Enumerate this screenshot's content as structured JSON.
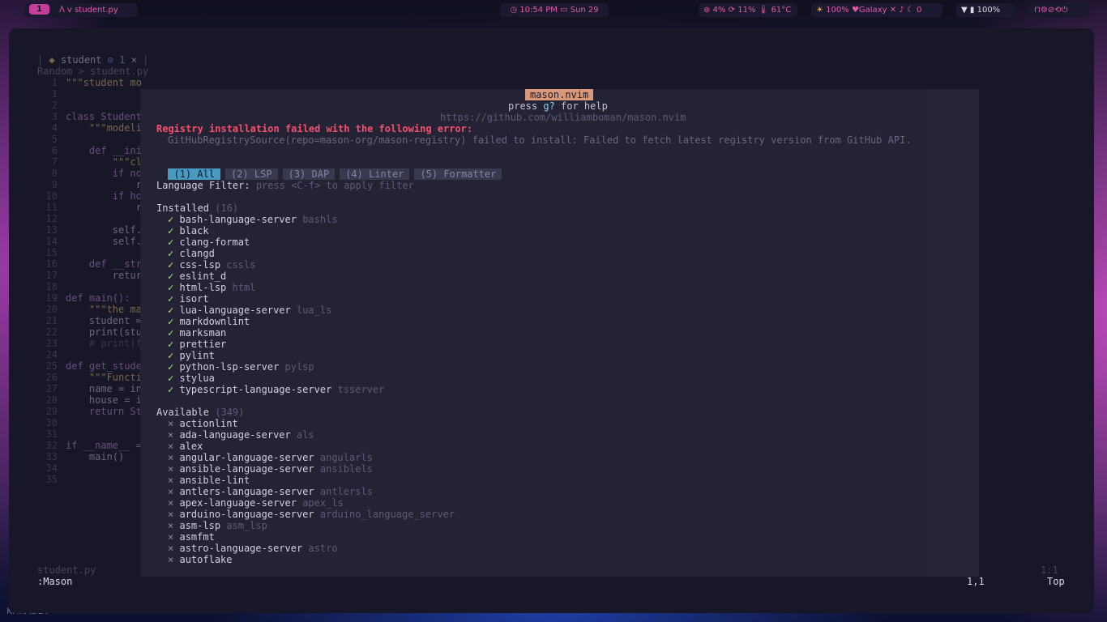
{
  "topbar": {
    "workspace": "1",
    "title": "ᐱ v student.py",
    "clock": "10:54 PM",
    "date": "Sun 29",
    "stats": "4%",
    "mem": "11%",
    "temp": "61°C",
    "brightness": "100%",
    "wifi": "Galaxy",
    "notif": "0",
    "battery": "100%"
  },
  "editor": {
    "tab_name": "student",
    "tab_diag": "1",
    "tab_close": "×",
    "breadcrumb": "Random > student.py",
    "line_numbers": [
      "1",
      "1",
      "2",
      "3",
      "4",
      "5",
      "6",
      "7",
      "8",
      "9",
      "10",
      "11",
      "12",
      "13",
      "14",
      "15",
      "16",
      "17",
      "18",
      "19",
      "20",
      "21",
      "22",
      "23",
      "24",
      "25",
      "26",
      "27",
      "28",
      "29",
      "30",
      "31",
      "32",
      "33",
      "34",
      "35"
    ],
    "lines": [
      "\"\"\"student mo",
      "",
      "",
      "class Student",
      "    \"\"\"modeli",
      "",
      "    def __ini",
      "        \"\"\"cl",
      "        if no",
      "            r",
      "        if ho",
      "            r",
      "",
      "        self.",
      "        self.",
      "",
      "    def __str",
      "        retur",
      "",
      "def main():",
      "    \"\"\"the ma",
      "    student =",
      "    print(stu",
      "    # print(f",
      "",
      "def get_stude",
      "    \"\"\"Functi",
      "    name = in",
      "    house = i",
      "    return St",
      "",
      "",
      "if __name__ =",
      "    main()"
    ],
    "status_file": "student.py",
    "status_pos": "1:1",
    "cmdline": ":Mason",
    "cursor": "1,1",
    "scroll": "Top"
  },
  "mason": {
    "title": "mason.nvim",
    "help_press": "press ",
    "help_key": "g?",
    "help_rest": " for help",
    "url": "https://github.com/williamboman/mason.nvim",
    "error_title": "Registry installation failed with the following error:",
    "error_detail": "GitHubRegistrySource(repo=mason-org/mason-registry) failed to install: Failed to fetch latest registry version from GitHub API.",
    "tabs": [
      "(1) All",
      "(2) LSP",
      "(3) DAP",
      "(4) Linter",
      "(5) Formatter"
    ],
    "filter_label": "Language Filter: ",
    "filter_hint": "press <C-f> to apply filter",
    "installed_label": "Installed ",
    "installed_count": "(16)",
    "installed": [
      {
        "name": "bash-language-server",
        "alias": "bashls"
      },
      {
        "name": "black",
        "alias": ""
      },
      {
        "name": "clang-format",
        "alias": ""
      },
      {
        "name": "clangd",
        "alias": ""
      },
      {
        "name": "css-lsp",
        "alias": "cssls"
      },
      {
        "name": "eslint_d",
        "alias": ""
      },
      {
        "name": "html-lsp",
        "alias": "html"
      },
      {
        "name": "isort",
        "alias": ""
      },
      {
        "name": "lua-language-server",
        "alias": "lua_ls"
      },
      {
        "name": "markdownlint",
        "alias": ""
      },
      {
        "name": "marksman",
        "alias": ""
      },
      {
        "name": "prettier",
        "alias": ""
      },
      {
        "name": "pylint",
        "alias": ""
      },
      {
        "name": "python-lsp-server",
        "alias": "pylsp"
      },
      {
        "name": "stylua",
        "alias": ""
      },
      {
        "name": "typescript-language-server",
        "alias": "tsserver"
      }
    ],
    "available_label": "Available ",
    "available_count": "(349)",
    "available": [
      {
        "name": "actionlint",
        "alias": ""
      },
      {
        "name": "ada-language-server",
        "alias": "als"
      },
      {
        "name": "alex",
        "alias": ""
      },
      {
        "name": "angular-language-server",
        "alias": "angularls"
      },
      {
        "name": "ansible-language-server",
        "alias": "ansiblels"
      },
      {
        "name": "ansible-lint",
        "alias": ""
      },
      {
        "name": "antlers-language-server",
        "alias": "antlersls"
      },
      {
        "name": "apex-language-server",
        "alias": "apex_ls"
      },
      {
        "name": "arduino-language-server",
        "alias": "arduino_language_server"
      },
      {
        "name": "asm-lsp",
        "alias": "asm_lsp"
      },
      {
        "name": "asmfmt",
        "alias": ""
      },
      {
        "name": "astro-language-server",
        "alias": "astro"
      },
      {
        "name": "autoflake",
        "alias": ""
      }
    ],
    "mark_ok": "✓",
    "mark_no": "×"
  },
  "watermark": "KHRADEV",
  "colors": {
    "accent": "#c43e9a",
    "error": "#ff5370",
    "tab_active": "#4aa0c8",
    "header": "#e19f7d"
  }
}
